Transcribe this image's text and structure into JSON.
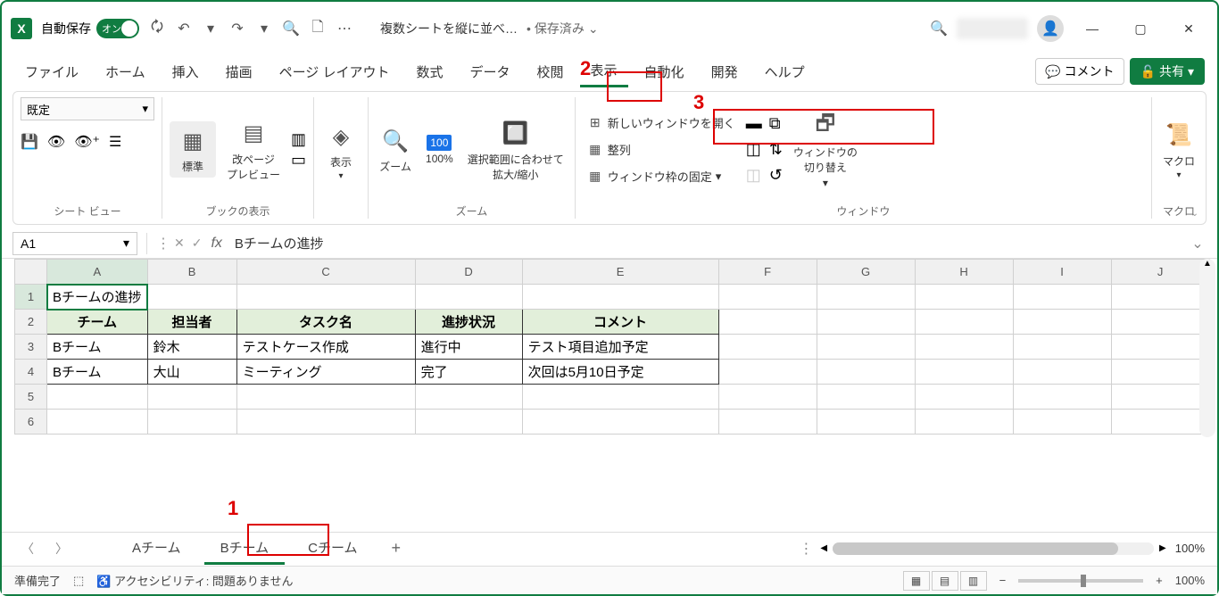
{
  "title_bar": {
    "autosave_label": "自動保存",
    "autosave_state": "オン",
    "file_title": "複数シートを縦に並べ…",
    "saved_status": "保存済み"
  },
  "tabs": {
    "file": "ファイル",
    "home": "ホーム",
    "insert": "挿入",
    "draw": "描画",
    "page_layout": "ページ レイアウト",
    "formulas": "数式",
    "data": "データ",
    "review": "校閲",
    "view": "表示",
    "automate": "自動化",
    "developer": "開発",
    "help": "ヘルプ",
    "comment_btn": "コメント",
    "share_btn": "共有"
  },
  "ribbon": {
    "sheet_view": {
      "dropdown": "既定",
      "label": "シート ビュー"
    },
    "workbook_views": {
      "normal": "標準",
      "page_break": "改ページ\nプレビュー",
      "label": "ブックの表示"
    },
    "show": {
      "btn": "表示",
      "label": ""
    },
    "zoom": {
      "zoom_btn": "ズーム",
      "hundred": "100%",
      "fit_selection": "選択範囲に合わせて\n拡大/縮小",
      "label": "ズーム"
    },
    "window": {
      "new_window": "新しいウィンドウを開く",
      "arrange": "整列",
      "freeze": "ウィンドウ枠の固定",
      "switch": "ウィンドウの\n切り替え",
      "label": "ウィンドウ"
    },
    "macro": {
      "btn": "マクロ",
      "label": "マクロ"
    }
  },
  "formula_bar": {
    "cell_ref": "A1",
    "formula": "Bチームの進捗"
  },
  "grid": {
    "cols": [
      "A",
      "B",
      "C",
      "D",
      "E",
      "F",
      "G",
      "H",
      "I",
      "J"
    ],
    "title_cell": "Bチームの進捗",
    "headers": [
      "チーム",
      "担当者",
      "タスク名",
      "進捗状況",
      "コメント"
    ],
    "rows": [
      [
        "Bチーム",
        "鈴木",
        "テストケース作成",
        "進行中",
        "テスト項目追加予定"
      ],
      [
        "Bチーム",
        "大山",
        "ミーティング",
        "完了",
        "次回は5月10日予定"
      ]
    ]
  },
  "sheets": {
    "a": "Aチーム",
    "b": "Bチーム",
    "c": "Cチーム"
  },
  "status": {
    "ready": "準備完了",
    "accessibility": "アクセシビリティ: 問題ありません",
    "zoom": "100%"
  },
  "annotations": {
    "one": "1",
    "two": "2",
    "three": "3"
  },
  "hscroll_zoom": "100%"
}
